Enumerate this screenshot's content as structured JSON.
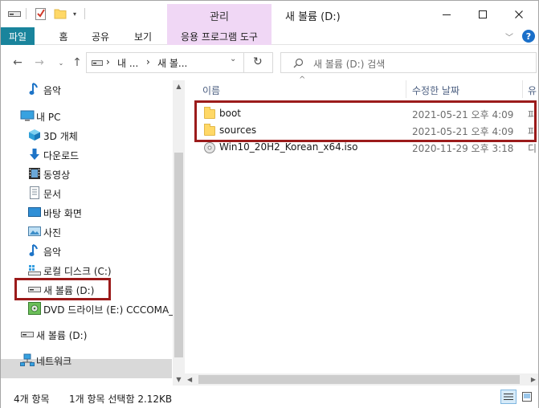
{
  "window": {
    "title": "새 볼륨 (D:)",
    "context_tab_header": "관리"
  },
  "ribbon": {
    "tabs": [
      "파일",
      "홈",
      "공유",
      "보기",
      "응용 프로그램 도구"
    ]
  },
  "address": {
    "segments": [
      "내 ...",
      "새 볼..."
    ],
    "search_placeholder": "새 볼륨 (D:) 검색"
  },
  "nav": {
    "items": [
      {
        "label": "음악",
        "icon": "music-icon"
      },
      {
        "label": "내 PC",
        "icon": "pc-icon"
      },
      {
        "label": "3D 개체",
        "icon": "3d-objects-icon"
      },
      {
        "label": "다운로드",
        "icon": "download-icon"
      },
      {
        "label": "동영상",
        "icon": "video-icon"
      },
      {
        "label": "문서",
        "icon": "document-icon"
      },
      {
        "label": "바탕 화면",
        "icon": "desktop-icon"
      },
      {
        "label": "사진",
        "icon": "pictures-icon"
      },
      {
        "label": "음악",
        "icon": "music-icon"
      },
      {
        "label": "로컬 디스크 (C:)",
        "icon": "local-disk-icon"
      },
      {
        "label": "새 볼륨 (D:)",
        "icon": "drive-icon"
      },
      {
        "label": "DVD 드라이브 (E:) CCCOMA_",
        "icon": "dvd-drive-icon"
      },
      {
        "label": "새 볼륨 (D:)",
        "icon": "drive-icon"
      },
      {
        "label": "네트워크",
        "icon": "network-icon"
      }
    ]
  },
  "columns": {
    "name": "이름",
    "modified": "수정한 날짜",
    "type": "유"
  },
  "files": [
    {
      "name": "boot",
      "modified": "2021-05-21 오후 4:09",
      "type": "파",
      "icon": "folder-icon"
    },
    {
      "name": "sources",
      "modified": "2021-05-21 오후 4:09",
      "type": "파",
      "icon": "folder-icon"
    },
    {
      "name": "Win10_20H2_Korean_x64.iso",
      "modified": "2020-11-29 오후 3:18",
      "type": "디",
      "icon": "disc-image-icon"
    }
  ],
  "status": {
    "item_count": "4개 항목",
    "selection": "1개 항목 선택함 2.12KB"
  },
  "colors": {
    "file_tab": "#19849c",
    "manage_tab": "#f0d7f5",
    "highlight_box": "#9b1b1b",
    "folder": "#ffd866"
  }
}
